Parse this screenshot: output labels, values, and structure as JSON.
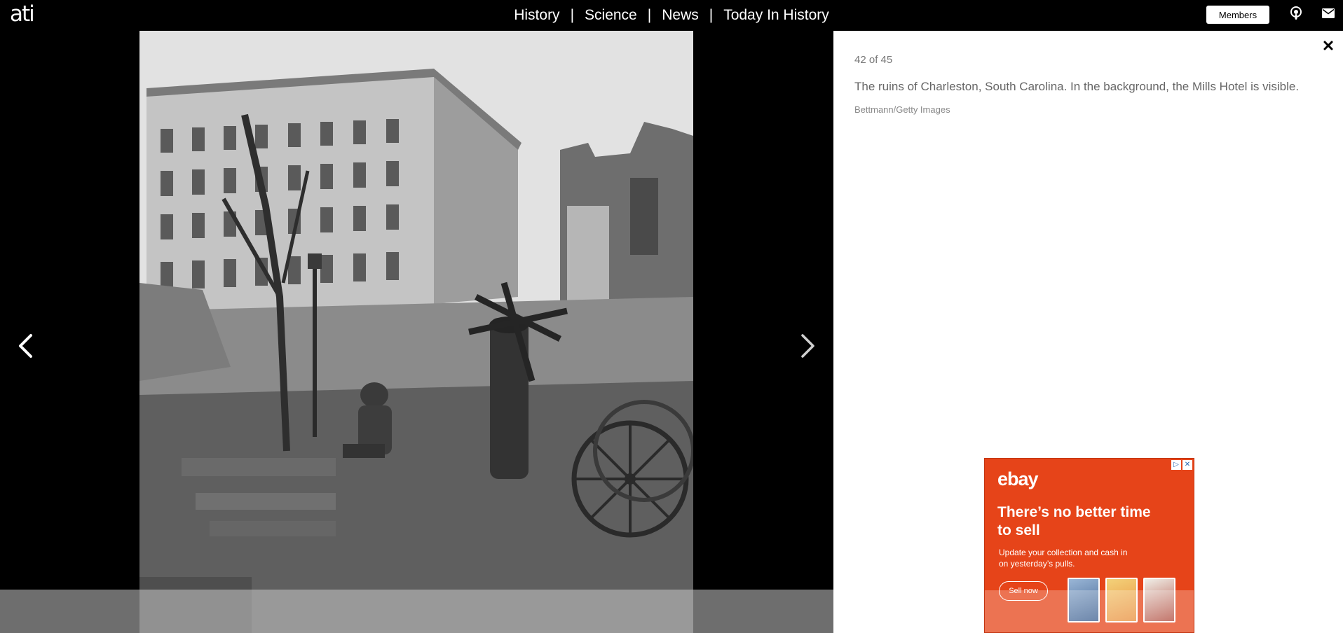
{
  "header": {
    "logo_text": "ati",
    "nav": [
      {
        "label": "History"
      },
      {
        "label": "Science"
      },
      {
        "label": "News"
      },
      {
        "label": "Today In History"
      }
    ],
    "separator": "|",
    "members_label": "Members",
    "icons": [
      "podcast-icon",
      "mail-icon"
    ]
  },
  "gallery": {
    "counter": "42 of 45",
    "caption": "The ruins of Charleston, South Carolina. In the background, the Mills Hotel is visible.",
    "credit": "Bettmann/Getty Images",
    "prev_icon": "chevron-left-icon",
    "next_icon": "chevron-right-icon",
    "close_icon": "close-icon"
  },
  "ad": {
    "brand": "ebay",
    "headline": "There’s no better time to sell",
    "body": "Update your collection and cash in on yesterday’s pulls.",
    "button_label": "Sell now",
    "choices_icons": [
      "adchoices-icon",
      "close-icon"
    ],
    "colors": {
      "background": "#e64419"
    }
  }
}
